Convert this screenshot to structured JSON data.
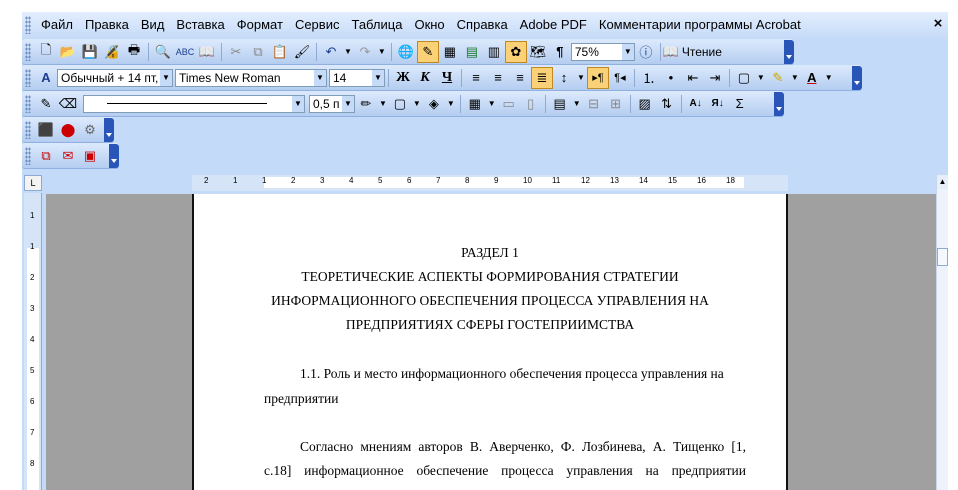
{
  "menubar": {
    "items": [
      "Файл",
      "Правка",
      "Вид",
      "Вставка",
      "Формат",
      "Сервис",
      "Таблица",
      "Окно",
      "Справка",
      "Adobe PDF",
      "Комментарии программы Acrobat"
    ],
    "close_label": "×"
  },
  "standard_toolbar": {
    "zoom_value": "75%",
    "reading_label": "Чтение"
  },
  "formatting_toolbar": {
    "style_value": "Обычный + 14 пт,",
    "font_value": "Times New Roman",
    "size_value": "14",
    "bold_label": "Ж",
    "italic_label": "К",
    "underline_label": "Ч"
  },
  "drawing_toolbar": {
    "line_weight_value": "0,5 п"
  },
  "ruler": {
    "corner_label": "L",
    "h_labels": [
      "2",
      "1",
      "1",
      "2",
      "3",
      "4",
      "5",
      "6",
      "7",
      "8",
      "9",
      "10",
      "11",
      "12",
      "13",
      "14",
      "15",
      "16",
      "18"
    ],
    "v_labels": [
      "1",
      "1",
      "2",
      "3",
      "4",
      "5",
      "6",
      "7",
      "8"
    ]
  },
  "document": {
    "section": "РАЗДЕЛ 1",
    "title_lines": [
      "ТЕОРЕТИЧЕСКИЕ АСПЕКТЫ ФОРМИРОВАНИЯ СТРАТЕГИИ",
      "ИНФОРМАЦИОННОГО ОБЕСПЕЧЕНИЯ ПРОЦЕССА УПРАВЛЕНИЯ НА",
      "ПРЕДПРИЯТИЯХ СФЕРЫ ГОСТЕПРИИМСТВА"
    ],
    "subheading_line1": "1.1. Роль и место информационного обеспечения процесса управления на",
    "subheading_line2": "предприятии",
    "body_line1": "Согласно мнениям авторов В. Аверченко, Ф. Лозбинева, А. Тищенко [1,",
    "body_line2": "с.18] информационное обеспечение процесса управления на предприятии"
  }
}
